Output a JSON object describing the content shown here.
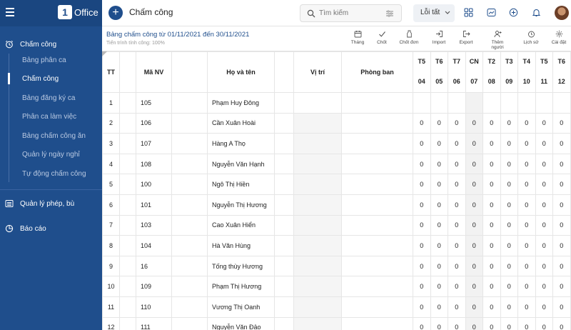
{
  "app": {
    "logo_mark": "1",
    "logo_text": "Office"
  },
  "sidebar": {
    "groups": [
      {
        "label": "Chấm công",
        "items": [
          {
            "label": "Bảng phân ca"
          },
          {
            "label": "Chấm công"
          },
          {
            "label": "Bảng đăng ký ca"
          },
          {
            "label": "Phân ca làm việc"
          },
          {
            "label": "Bảng chấm công ăn"
          },
          {
            "label": "Quản lý ngày nghỉ"
          },
          {
            "label": "Tự động chấm công"
          }
        ]
      },
      {
        "label": "Quản lý phép, bù"
      },
      {
        "label": "Báo cáo"
      }
    ],
    "active_item": "Chấm công"
  },
  "topbar": {
    "title": "Chấm công",
    "search_placeholder": "Tìm kiếm",
    "errors_label": "Lỗi tất",
    "icons": [
      "grid-icon",
      "chart-icon",
      "compass-icon",
      "bell-icon"
    ]
  },
  "subheader": {
    "range_title": "Bảng chấm công từ 01/11/2021 đến 30/11/2021",
    "progress_text": "Tiến trình tính công: 100%",
    "actions": [
      "Tháng",
      "Chốt",
      "Chốt đơn",
      "Import",
      "Export",
      "Thêm người",
      "Lịch sử",
      "Cài đặt"
    ]
  },
  "table": {
    "headers": {
      "tt": "TT",
      "ma_nv": "Mã NV",
      "name": "Họ và tên",
      "position": "Vị trí",
      "dept": "Phòng ban"
    },
    "days": [
      {
        "dow": "T5",
        "num": "04"
      },
      {
        "dow": "T6",
        "num": "05"
      },
      {
        "dow": "T7",
        "num": "06"
      },
      {
        "dow": "CN",
        "num": "07"
      },
      {
        "dow": "T2",
        "num": "08"
      },
      {
        "dow": "T3",
        "num": "09"
      },
      {
        "dow": "T4",
        "num": "10"
      },
      {
        "dow": "T5",
        "num": "11"
      },
      {
        "dow": "T6",
        "num": "12"
      }
    ],
    "rows": [
      {
        "tt": "1",
        "ma": "105",
        "name": "Phạm Huy Đông",
        "vals": [
          "",
          "",
          "",
          "",
          "",
          "",
          "",
          "",
          ""
        ]
      },
      {
        "tt": "2",
        "ma": "106",
        "name": "Cần Xuân Hoài",
        "vals": [
          "0",
          "0",
          "0",
          "0",
          "0",
          "0",
          "0",
          "0",
          "0"
        ]
      },
      {
        "tt": "3",
        "ma": "107",
        "name": "Hàng A Thọ",
        "vals": [
          "0",
          "0",
          "0",
          "0",
          "0",
          "0",
          "0",
          "0",
          "0"
        ]
      },
      {
        "tt": "4",
        "ma": "108",
        "name": "Nguyễn Văn Hạnh",
        "vals": [
          "0",
          "0",
          "0",
          "0",
          "0",
          "0",
          "0",
          "0",
          "0"
        ]
      },
      {
        "tt": "5",
        "ma": "100",
        "name": "Ngô Thị Hiền",
        "vals": [
          "0",
          "0",
          "0",
          "0",
          "0",
          "0",
          "0",
          "0",
          "0"
        ]
      },
      {
        "tt": "6",
        "ma": "101",
        "name": "Nguyễn Thị Hương",
        "vals": [
          "0",
          "0",
          "0",
          "0",
          "0",
          "0",
          "0",
          "0",
          "0"
        ]
      },
      {
        "tt": "7",
        "ma": "103",
        "name": "Cao Xuân Hiển",
        "vals": [
          "0",
          "0",
          "0",
          "0",
          "0",
          "0",
          "0",
          "0",
          "0"
        ]
      },
      {
        "tt": "8",
        "ma": "104",
        "name": "Hà Văn Hùng",
        "vals": [
          "0",
          "0",
          "0",
          "0",
          "0",
          "0",
          "0",
          "0",
          "0"
        ]
      },
      {
        "tt": "9",
        "ma": "16",
        "name": "Tống thùy Hương",
        "vals": [
          "0",
          "0",
          "0",
          "0",
          "0",
          "0",
          "0",
          "0",
          "0"
        ]
      },
      {
        "tt": "10",
        "ma": "109",
        "name": "Phạm Thị Hương",
        "vals": [
          "0",
          "0",
          "0",
          "0",
          "0",
          "0",
          "0",
          "0",
          "0"
        ]
      },
      {
        "tt": "11",
        "ma": "110",
        "name": "Vương Thị Oanh",
        "vals": [
          "0",
          "0",
          "0",
          "0",
          "0",
          "0",
          "0",
          "0",
          "0"
        ]
      },
      {
        "tt": "12",
        "ma": "111",
        "name": "Nguyễn Văn Đảo",
        "vals": [
          "0",
          "0",
          "0",
          "0",
          "0",
          "0",
          "0",
          "0",
          "0"
        ]
      }
    ]
  }
}
